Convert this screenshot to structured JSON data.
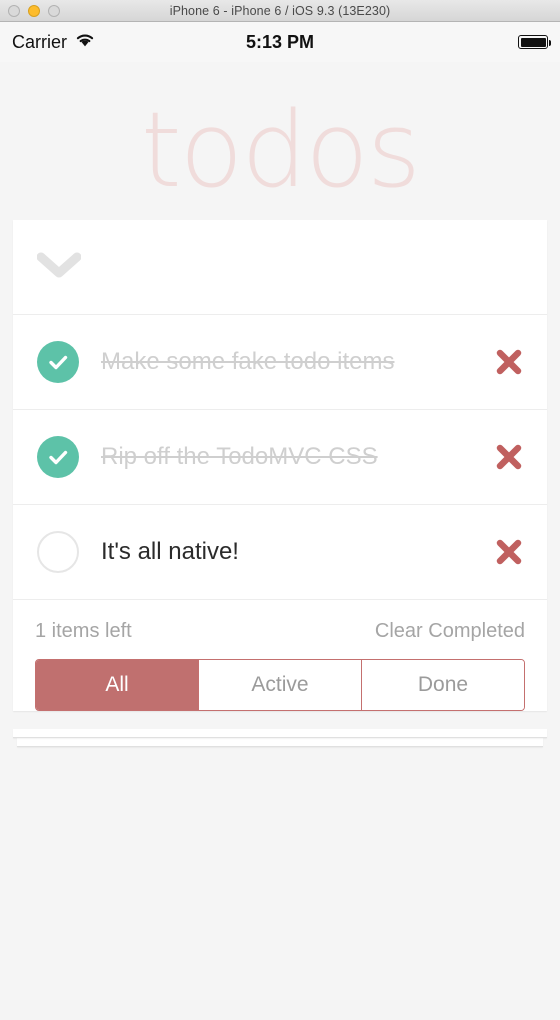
{
  "window": {
    "title": "iPhone 6 - iPhone 6 / iOS 9.3 (13E230)",
    "traffic_lights": [
      {
        "name": "close",
        "color": "#d9d9d9",
        "enabled": false
      },
      {
        "name": "minimize",
        "color": "#fdbc2c",
        "enabled": true
      },
      {
        "name": "maximize",
        "color": "#d9d9d9",
        "enabled": false
      }
    ]
  },
  "status_bar": {
    "carrier": "Carrier",
    "wifi_icon": "wifi-icon",
    "time": "5:13 PM",
    "battery_icon": "battery-full-icon",
    "battery_level": 100
  },
  "app": {
    "title": "todos",
    "title_color": "#f0dcdb",
    "toggle_all_icon": "chevron-down-icon",
    "new_todo_placeholder": "",
    "new_todo_value": "",
    "todos": [
      {
        "label": "Make some fake todo items",
        "completed": true
      },
      {
        "label": "Rip off the TodoMVC CSS",
        "completed": true
      },
      {
        "label": "It's all native!",
        "completed": false
      }
    ],
    "footer": {
      "items_left": "1 items left",
      "clear_completed": "Clear Completed",
      "filters": [
        {
          "label": "All",
          "selected": true
        },
        {
          "label": "Active",
          "selected": false
        },
        {
          "label": "Done",
          "selected": false
        }
      ]
    },
    "colors": {
      "accent_check": "#5dc2a8",
      "accent_destroy": "#c0605f",
      "accent_filter": "#c0706f",
      "title": "#f0dcdb",
      "completed_text": "#cfcfcf"
    }
  }
}
